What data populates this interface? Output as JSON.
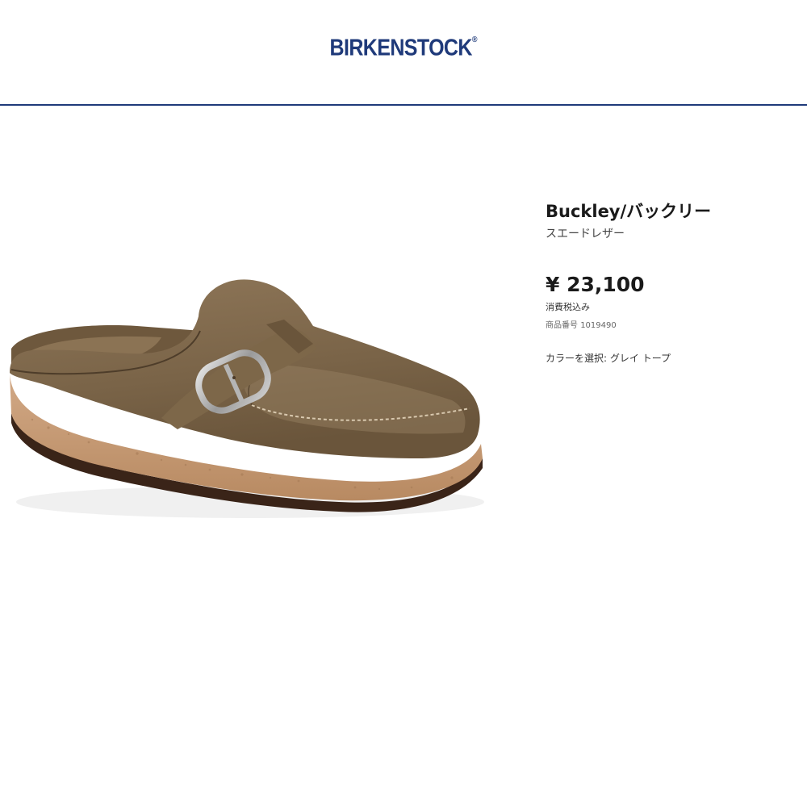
{
  "header": {
    "brand": "BIRKENSTOCK",
    "brand_mark": "®"
  },
  "product": {
    "name": "Buckley/バックリー",
    "material": "スエードレザー",
    "price": "¥ 23,100",
    "tax_note": "消費税込み",
    "sku_label": "商品番号",
    "sku": "1019490",
    "color_label": "カラーを選択:",
    "color_value": "グレイ トープ"
  }
}
